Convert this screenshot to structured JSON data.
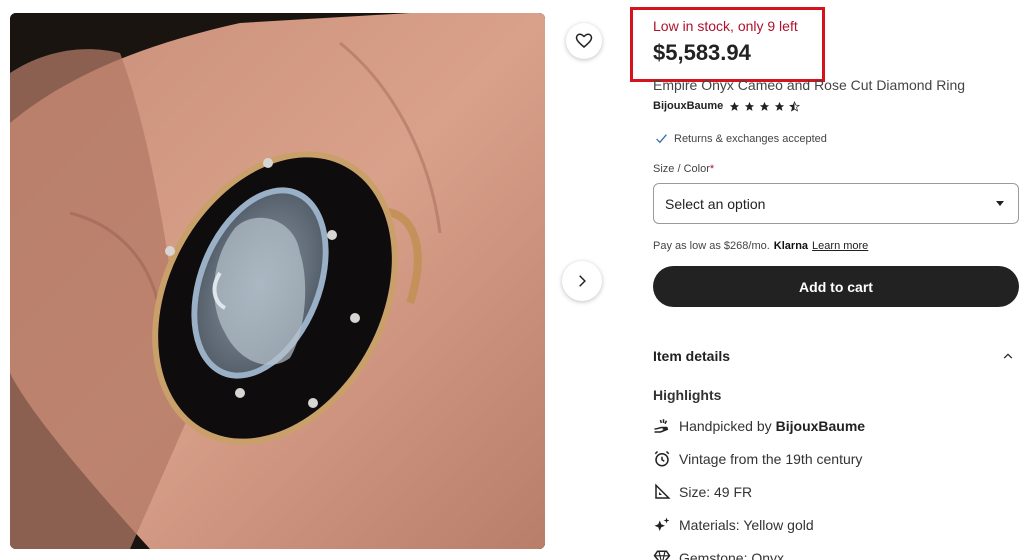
{
  "product": {
    "stock_notice": "Low in stock, only 9 left",
    "price": "$5,583.94",
    "title": "Empire Onyx Cameo and Rose Cut Diamond Ring",
    "shop_name": "BijouxBaume",
    "rating_stars": 4.5,
    "returns_text": "Returns & exchanges accepted"
  },
  "options": {
    "size_label": "Size / Color",
    "required_mark": "*",
    "select_value": "Select an option"
  },
  "financing": {
    "text": "Pay as low as $268/mo.",
    "provider": "Klarna",
    "learn_more": "Learn more"
  },
  "actions": {
    "add_to_cart": "Add to cart"
  },
  "details": {
    "heading": "Item details",
    "highlights_heading": "Highlights",
    "handpicked_prefix": "Handpicked by",
    "handpicked_shop": "BijouxBaume",
    "vintage": "Vintage from the 19th century",
    "size": "Size: 49 FR",
    "materials": "Materials: Yellow gold",
    "gemstone": "Gemstone: Onyx"
  },
  "colors": {
    "accent_red": "#d6121e",
    "stock_red": "#b0112b",
    "button_dark": "#222222"
  },
  "icons": [
    "heart-icon",
    "chevron-right-icon",
    "star-icon",
    "check-icon",
    "dropdown-caret-icon",
    "chevron-up-icon",
    "hand-icon",
    "clock-icon",
    "ruler-icon",
    "sparkle-icon",
    "gem-icon"
  ]
}
